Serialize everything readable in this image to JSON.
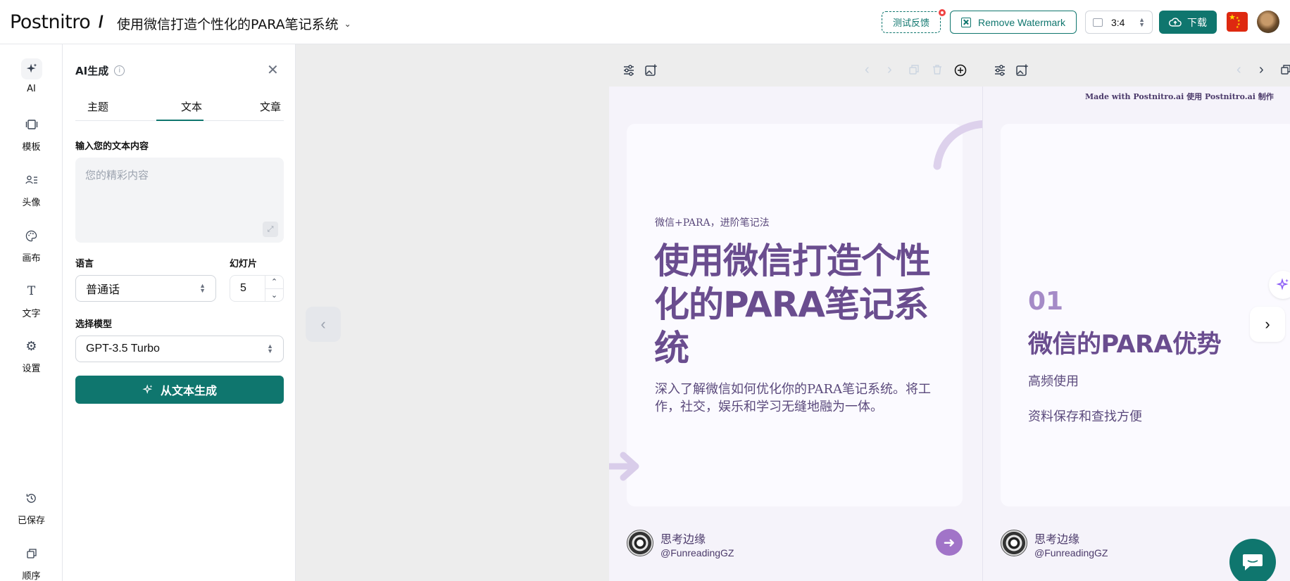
{
  "header": {
    "logo": "Postnitro",
    "separator": "/",
    "doc_title": "使用微信打造个性化的PARA笔记系统",
    "feedback_label": "测试反馈",
    "remove_watermark_label": "Remove Watermark",
    "ratio_value": "3:4",
    "download_label": "下载"
  },
  "rail": {
    "items": [
      {
        "label": "AI",
        "icon": "sparkle-icon"
      },
      {
        "label": "模板",
        "icon": "template-icon"
      },
      {
        "label": "头像",
        "icon": "profile-icon"
      },
      {
        "label": "画布",
        "icon": "palette-icon"
      },
      {
        "label": "文字",
        "icon": "text-icon"
      },
      {
        "label": "设置",
        "icon": "gear-icon"
      },
      {
        "label": "已保存",
        "icon": "history-icon"
      },
      {
        "label": "顺序",
        "icon": "order-icon"
      }
    ]
  },
  "panel": {
    "title": "AI生成",
    "tabs": [
      "主题",
      "文本",
      "文章"
    ],
    "active_tab": "文本",
    "text_label": "输入您的文本内容",
    "text_placeholder": "您的精彩内容",
    "language_label": "语言",
    "language_value": "普通话",
    "slides_label": "幻灯片",
    "slides_value": "5",
    "model_label": "选择模型",
    "model_value": "GPT-3.5 Turbo",
    "generate_label": "从文本生成"
  },
  "slide1": {
    "kicker": "微信+PARA，进阶笔记法",
    "headline": "使用微信打造个性化的PARA笔记系统",
    "subtext": "深入了解微信如何优化你的PARA笔记系统。将工作，社交，娱乐和学习无缝地融为一体。",
    "author_name": "思考边缘",
    "author_handle": "@FunreadingGZ"
  },
  "slide2": {
    "watermark": "Made with Postnitro.ai 使用 Postnitro.ai 制作",
    "number": "01",
    "title": "微信的PARA优势",
    "items": [
      "高频使用",
      "资料保存和查找方便"
    ],
    "author_name": "思考边缘",
    "author_handle": "@FunreadingGZ"
  },
  "colors": {
    "brand": "#0f766e",
    "slide_purple": "#6a4d8f",
    "accent_purple": "#a174c8"
  }
}
